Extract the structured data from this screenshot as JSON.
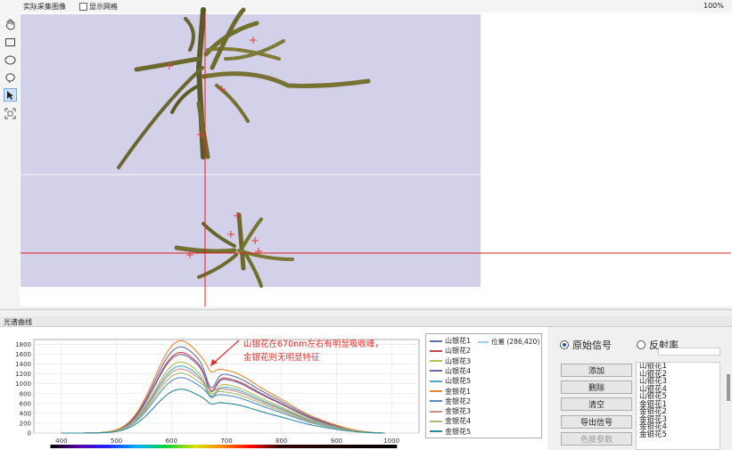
{
  "topbar": {
    "title": "实际采集图像",
    "show_grid_label": "显示网格",
    "show_grid_checked": false,
    "zoom": "100%"
  },
  "toolbar": {
    "tools": [
      "hand-icon",
      "rectangle-icon",
      "ellipse-icon",
      "lasso-icon",
      "pointer-icon",
      "fit-icon"
    ],
    "active": "pointer-icon"
  },
  "panel": {
    "title": "光谱曲线"
  },
  "chart_data": {
    "type": "line",
    "xlim": [
      350,
      1050
    ],
    "ylim": [
      0,
      1900
    ],
    "x_ticks": [
      400,
      500,
      600,
      700,
      800,
      900,
      1000
    ],
    "y_ticks": [
      0,
      200,
      400,
      600,
      800,
      1000,
      1200,
      1400,
      1600,
      1800
    ],
    "annotation": [
      "山银花在670nm左右有明显吸收峰，",
      "金银花则无明显特征"
    ],
    "cursor_label": "位置 (286,420)",
    "series": [
      {
        "name": "山银花1",
        "color": "#5b6fa8",
        "peak": 1710,
        "type": "shanyin"
      },
      {
        "name": "山银花2",
        "color": "#c04a4a",
        "peak": 1600,
        "type": "shanyin"
      },
      {
        "name": "山银花3",
        "color": "#b5bf52",
        "peak": 1410,
        "type": "shanyin"
      },
      {
        "name": "山银花4",
        "color": "#7a5fa6",
        "peak": 1560,
        "type": "shanyin"
      },
      {
        "name": "山银花5",
        "color": "#4aa8c4",
        "peak": 1330,
        "type": "shanyin"
      },
      {
        "name": "金银花1",
        "color": "#e8872e",
        "peak": 1830,
        "type": "jinyin"
      },
      {
        "name": "金银花2",
        "color": "#5a88c4",
        "peak": 1100,
        "type": "jinyin"
      },
      {
        "name": "金银花3",
        "color": "#d08a86",
        "peak": 1270,
        "type": "jinyin"
      },
      {
        "name": "金银花4",
        "color": "#a3bc6e",
        "peak": 1190,
        "type": "jinyin"
      },
      {
        "name": "金银花5",
        "color": "#2f8a9c",
        "peak": 870,
        "type": "jinyin"
      }
    ]
  },
  "controls": {
    "radio_raw": "原始信号",
    "radio_reflect": "反射率",
    "radio_raw_checked": true,
    "buttons": [
      "添加",
      "删除",
      "清空",
      "导出信号",
      "色度参数"
    ],
    "list": [
      "山银花1",
      "山银花2",
      "山银花3",
      "山银花4",
      "山银花5",
      "金银花1",
      "金银花2",
      "金银花3",
      "金银花4",
      "金银花5"
    ]
  }
}
